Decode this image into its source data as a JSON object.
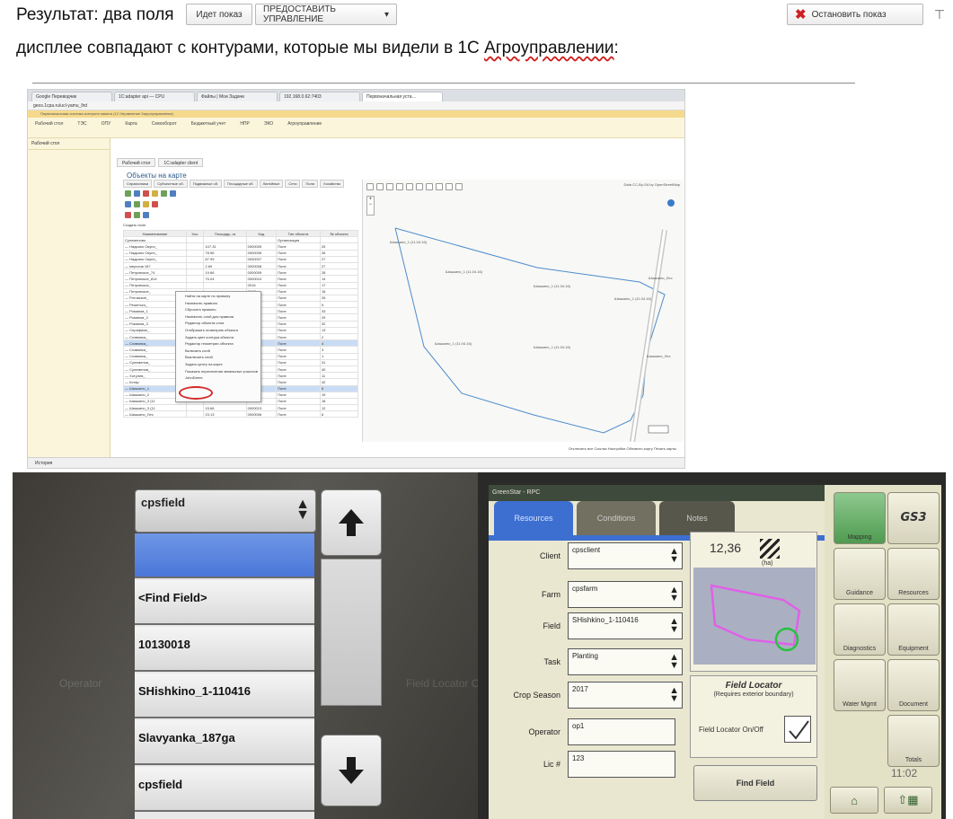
{
  "top": {
    "result_text": "Результат: два поля",
    "btn_show": "Идет показ",
    "btn_give_control": "ПРЕДОСТАВИТЬ УПРАВЛЕНИЕ",
    "btn_stop": "Остановить показ",
    "sub_text_prefix": "дисплее совпадают с контурами, которые мы видели в 1С ",
    "sub_text_word": "Агроуправлении",
    "sub_text_suffix": ":"
  },
  "browser": {
    "tabs": [
      "Google Переводчик",
      "1С:adapter api — CPU",
      "Файлы | Мои Задачи",
      "192.168.0.62:7403",
      "Первоначальная уста…"
    ],
    "url": "geos.1cpa.ru/ucl-yamu_lhd",
    "app_title": "Первоначальная система контроля памяти (1С:Управление Заргроуправление)",
    "menu": [
      "Рабочий стол",
      "ТЭС",
      "ОПУ",
      "Карта",
      "Севооборот",
      "Бюджетный учет",
      "НПР",
      "ЭКО",
      "Агроуправление"
    ],
    "left_panel": [
      "Рабочий стол"
    ],
    "content_tabs": [
      "Рабочий стол",
      "1С:adapter client"
    ],
    "panel_title": "Объекты на карте",
    "subtabs": [
      "Справочники",
      "Субъектные об.",
      "Подвижные об.",
      "Площадные об.",
      "Линейные",
      "Сети",
      "Поля",
      "Хозяйство"
    ],
    "create_label": "Создать поле",
    "grid_headers": [
      "Наименование",
      "Хоз.",
      "Площадь, га",
      "Код",
      "Тип объекта",
      "№ объекта"
    ],
    "grid_rows": [
      [
        "Сулеменово",
        "",
        "",
        "",
        "Организация",
        ""
      ],
      [
        "— Надьяно Окуно_",
        "",
        "107.31",
        "0000005",
        "Поле",
        "25"
      ],
      [
        "— Надьяно Окуно_",
        "",
        "78.56",
        "0000006",
        "Поле",
        "26"
      ],
      [
        "— Надьяно Окуно_",
        "",
        "87.99",
        "0000007",
        "Поле",
        "27"
      ],
      [
        "— мерохов 187",
        "",
        "2.69",
        "0000008",
        "Поле",
        "27"
      ],
      [
        "— Петровское_74",
        "",
        "19.66",
        "0000009",
        "Поле",
        "28"
      ],
      [
        "— Петровское_814",
        "",
        "75.04",
        "0000010",
        "Поле",
        "14"
      ],
      [
        "— Петровское_",
        "",
        "",
        "0016",
        "Поле",
        "17"
      ],
      [
        "— Петровское_",
        "",
        "",
        "0017",
        "Поле",
        "16"
      ],
      [
        "— Ротовское_",
        "",
        "",
        "0037",
        "Поле",
        "26"
      ],
      [
        "— Решетско_",
        "",
        "",
        "0002",
        "Поле",
        "9"
      ],
      [
        "— Романов_1",
        "",
        "",
        "0004",
        "Поле",
        "33"
      ],
      [
        "— Романов_2",
        "",
        "",
        "0006",
        "Поле",
        "29"
      ],
      [
        "— Романов_3",
        "",
        "",
        "0008",
        "Поле",
        "32"
      ],
      [
        "— Серафимо_",
        "",
        "",
        "0014",
        "Поле",
        "13"
      ],
      [
        "— Славянка_",
        "",
        "",
        "0003",
        "Поле",
        "2"
      ],
      [
        "— Славянка_",
        "",
        "",
        "0009",
        "Поле",
        "4"
      ],
      [
        "— Славянка_",
        "",
        "",
        "0004",
        "Поле",
        "3"
      ],
      [
        "— Славянка_",
        "",
        "",
        "0002",
        "Поле",
        "1"
      ],
      [
        "— Сулеменов_",
        "",
        "",
        "0008",
        "Поле",
        "31"
      ],
      [
        "— Сулеменов_",
        "",
        "",
        "0041",
        "Поле",
        "40"
      ],
      [
        "— Хотулев_",
        "",
        "",
        "0012",
        "Поле",
        "11"
      ],
      [
        "— Кстар",
        "",
        "",
        "0043",
        "Поле",
        "42"
      ],
      [
        "— Шишкино_1",
        "",
        "",
        "0019",
        "Поле",
        "6"
      ],
      [
        "— Шишкино_2",
        "",
        "1.57",
        "0000020",
        "Поле",
        "19"
      ],
      [
        "— Шишкино_3 (11",
        "",
        "6.77",
        "0000020",
        "Поле",
        "18"
      ],
      [
        "— Шишкино_3 (11",
        "",
        "15.66",
        "0000013",
        "Поле",
        "12"
      ],
      [
        "— Шишкино_Лес",
        "",
        "23.13",
        "0000006",
        "Поле",
        "6"
      ]
    ],
    "context_menu": [
      "Найти на карте по правилу",
      "Назначить правило",
      "Сбросить правило",
      "Назначить слой для правила",
      "Редактор объекта слоя",
      "Отобразить геометрию объекта",
      "Задать цвет контура объекта",
      "Редактор геометрии объекта",
      "Включить слой",
      "Выключить слой",
      "Задать центр на карте",
      "Показать пересечения земельных участков",
      "JohnDeere"
    ],
    "map_labels": [
      "Шишкино_1 (11.04.16)",
      "Шишкино_1 (11.04.16)",
      "Шишкино_1 (11.04.16)",
      "Шишкино_1 (11.04.16)",
      "Шишкино_Лес",
      "Шишкино_1 (11.04.16)",
      "Шишкино_1 (11.04.16)",
      "Шишкино_Лес"
    ],
    "map_copyright": "Data CC-By-SA by OpenStreetMap",
    "map_bottom": "Отключить все  Ссылка  Настройки  Обновить карту  Печать карты",
    "bottom_left": "История"
  },
  "left_photo": {
    "select_value": "cpsfield",
    "items": [
      "",
      "<Find Field>",
      "10130018",
      "SHishkino_1-110416",
      "Slavyanka_187ga",
      "cpsfield"
    ],
    "ghost_left": "Operator",
    "ghost_right": "Field Locator On/Off"
  },
  "gs3": {
    "title": "GreenStar - RPC",
    "tabs": [
      "Resources",
      "Conditions",
      "Notes"
    ],
    "rows": [
      {
        "label": "Client",
        "value": "cpsclient"
      },
      {
        "label": "Farm",
        "value": "cpsfarm"
      },
      {
        "label": "Field",
        "value": "SHishkino_1-110416"
      },
      {
        "label": "Task",
        "value": "Planting"
      },
      {
        "label": "Crop Season",
        "value": "2017"
      },
      {
        "label": "Operator",
        "value": "op1"
      },
      {
        "label": "Lic #",
        "value": "123"
      }
    ],
    "area_value": "12,36",
    "area_unit": "(ha)",
    "locator_title": "Field Locator",
    "locator_sub": "(Requires exterior boundary)",
    "locator_toggle": "Field Locator On/Off",
    "find_field": "Find Field",
    "side": [
      "Mapping",
      "GS3",
      "Guidance",
      "Resources",
      "Diagnostics",
      "Equipment",
      "Water Mgmt",
      "Document",
      "Totals"
    ],
    "time": "11:02"
  },
  "colors": {
    "stop_x": "#d02020",
    "highlight_blue": "#4a76d8",
    "boundary_pink": "#e060e8",
    "locator_green": "#28c040",
    "map_line": "#4d8ccc"
  }
}
